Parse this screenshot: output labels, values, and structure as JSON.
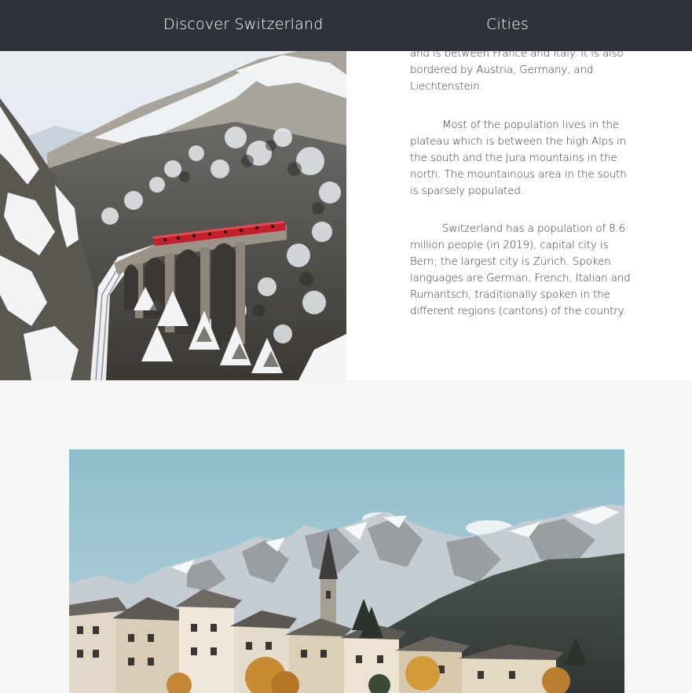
{
  "nav": {
    "brand": "Discover Switzerland",
    "cities": "Cities"
  },
  "intro": {
    "paragraphs": [
      "and is between France and Italy. It is also bordered by Austria, Germany, and Liechtenstein.",
      "Most of the population lives in the plateau which is between the high Alps in the south and the Jura mountains in the north. The mountainous area in the south is sparsely populated.",
      "Switzerland has a population of 8.6 million people (in 2019), capital city is Bern; the largest city is Zürich. Spoken languages are German, French, Italian and Rumantsch, traditionally spoken in the different regions (cantons) of the country."
    ]
  },
  "colors": {
    "nav_bg": "#2f323a",
    "nav_text": "#ffffff",
    "body_text": "#333333",
    "section_bg": "#f6f6f6",
    "train_red": "#c4202c"
  }
}
